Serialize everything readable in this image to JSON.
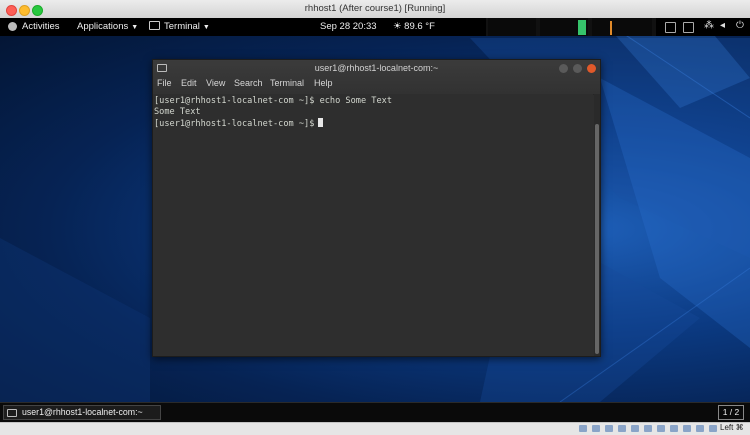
{
  "host": {
    "title": "rhhost1 (After course1) [Running]",
    "status_key_label": "Left ⌘"
  },
  "topbar": {
    "activities": "Activities",
    "applications": "Applications",
    "terminal_menu": "Terminal",
    "datetime": "Sep 28  20:33",
    "weather": "89.6 °F",
    "weather_icon": "sun-cloud-icon"
  },
  "terminal": {
    "title": "user1@rhhost1-localnet-com:~",
    "menus": [
      "File",
      "Edit",
      "View",
      "Search",
      "Terminal",
      "Help"
    ],
    "lines": [
      "[user1@rhhost1-localnet-com ~]$ echo Some Text",
      "Some Text",
      "[user1@rhhost1-localnet-com ~]$"
    ],
    "colors": {
      "background": "#2e2e2e",
      "text": "#d3d7cf",
      "close_button": "#e0592a"
    }
  },
  "taskbar": {
    "window_label": "user1@rhhost1-localnet-com:~",
    "workspace": "1 / 2"
  }
}
